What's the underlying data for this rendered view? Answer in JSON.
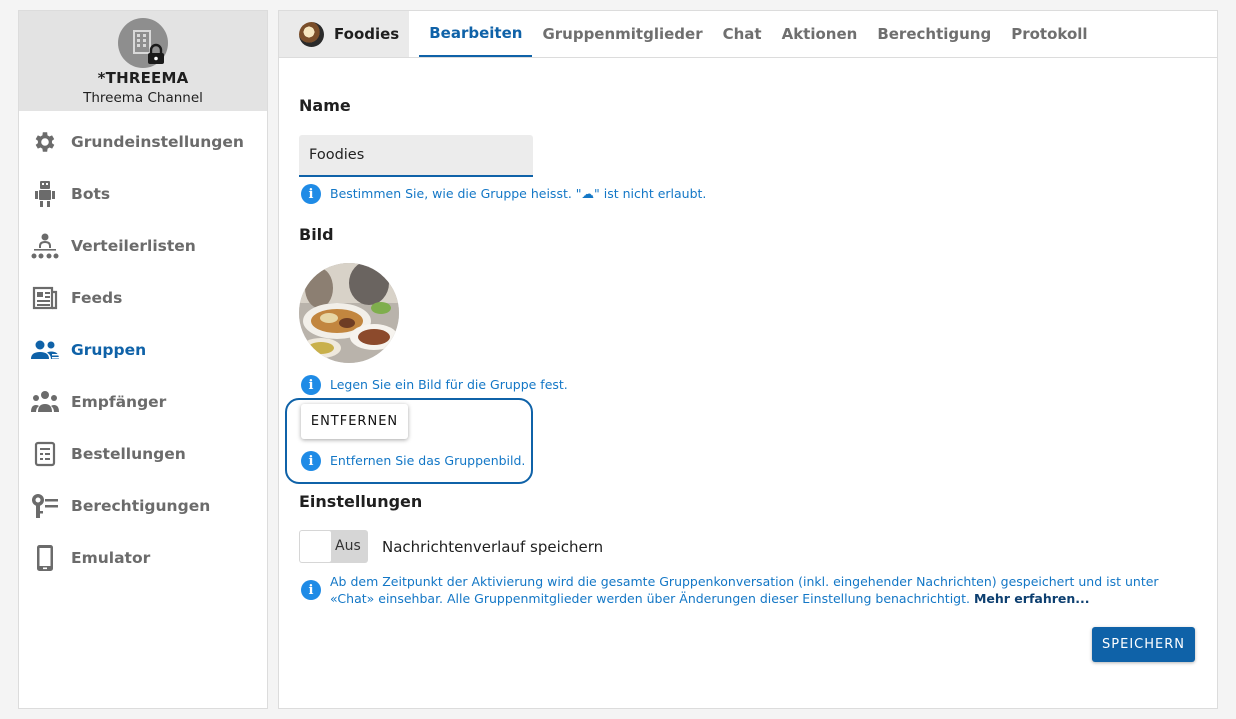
{
  "channel": {
    "name": "*THREEMA",
    "subtitle": "Threema Channel"
  },
  "sidebar": {
    "items": [
      {
        "label": "Grundeinstellungen",
        "icon": "gear-icon"
      },
      {
        "label": "Bots",
        "icon": "robot-icon"
      },
      {
        "label": "Verteilerlisten",
        "icon": "distribution-icon"
      },
      {
        "label": "Feeds",
        "icon": "feed-icon"
      },
      {
        "label": "Gruppen",
        "icon": "group-icon"
      },
      {
        "label": "Empfänger",
        "icon": "recipients-icon"
      },
      {
        "label": "Bestellungen",
        "icon": "orders-icon"
      },
      {
        "label": "Berechtigungen",
        "icon": "key-icon"
      },
      {
        "label": "Emulator",
        "icon": "phone-icon"
      }
    ],
    "active_index": 4
  },
  "tabs": {
    "group_name": "Foodies",
    "items": [
      "Bearbeiten",
      "Gruppenmitglieder",
      "Chat",
      "Aktionen",
      "Berechtigung",
      "Protokoll"
    ],
    "active_index": 0
  },
  "form": {
    "name_title": "Name",
    "name_value": "Foodies",
    "name_hint": "Bestimmen Sie, wie die Gruppe heisst. \"☁\" ist nicht erlaubt.",
    "image_title": "Bild",
    "image_hint": "Legen Sie ein Bild für die Gruppe fest.",
    "remove_label": "ENTFERNEN",
    "remove_hint": "Entfernen Sie das Gruppenbild.",
    "settings_title": "Einstellungen",
    "toggle_state": "Aus",
    "toggle_label": "Nachrichtenverlauf speichern",
    "history_hint": "Ab dem Zeitpunkt der Aktivierung wird die gesamte Gruppenkonversation (inkl. eingehender Nachrichten) gespeichert und ist unter «Chat» einsehbar. Alle Gruppenmitglieder werden über Änderungen dieser Einstellung benachrichtigt.",
    "history_link": "Mehr erfahren...",
    "save_label": "SPEICHERN"
  },
  "colors": {
    "accent": "#0f62a8",
    "hint": "#1377c6",
    "info_icon": "#1f8be6"
  }
}
